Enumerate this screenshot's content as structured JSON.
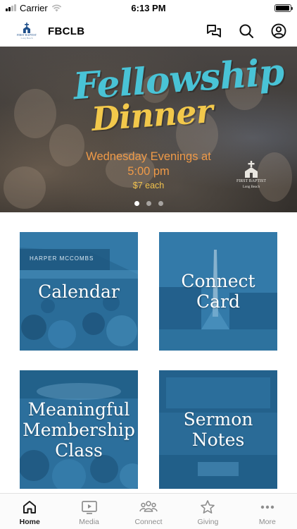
{
  "status_bar": {
    "carrier": "Carrier",
    "time": "6:13 PM",
    "battery_level": 0.95
  },
  "header": {
    "logo_text": "FIRST BAPTIST",
    "logo_subtext": "Long Beach",
    "title": "FBCLB",
    "actions": [
      {
        "name": "messages-icon"
      },
      {
        "name": "search-icon"
      },
      {
        "name": "profile-icon"
      }
    ]
  },
  "banner": {
    "title_line1": "Fellowship",
    "title_line2": "Dinner",
    "when_line1": "Wednesday Evenings at",
    "when_line2": "5:00 pm",
    "price": "$7 each",
    "logo_text": "FIRST BAPTIST",
    "logo_subtext": "Long Beach",
    "slide_count": 3,
    "active_slide": 1,
    "colors": {
      "title1": "#49c3d6",
      "title2": "#f2c84b",
      "when": "#ef9a48",
      "price": "#f1c24d"
    }
  },
  "tiles": [
    {
      "id": "calendar",
      "label_lines": [
        "Calendar"
      ],
      "sign_text": "HARPER MCCOMBS"
    },
    {
      "id": "connect",
      "label_lines": [
        "Connect",
        "Card"
      ]
    },
    {
      "id": "membership",
      "label_lines": [
        "Meaningful",
        "Membership",
        "Class"
      ]
    },
    {
      "id": "sermon",
      "label_lines": [
        "Sermon",
        "Notes"
      ]
    }
  ],
  "tab_bar": {
    "items": [
      {
        "label": "Home",
        "icon": "home-icon",
        "active": true
      },
      {
        "label": "Media",
        "icon": "media-icon",
        "active": false
      },
      {
        "label": "Connect",
        "icon": "people-icon",
        "active": false
      },
      {
        "label": "Giving",
        "icon": "star-icon",
        "active": false
      },
      {
        "label": "More",
        "icon": "more-dots-icon",
        "active": false
      }
    ]
  },
  "theme": {
    "accent_blue": "#2a6c98",
    "tab_active": "#1c1c1c",
    "tab_inactive": "#8e8e8e"
  }
}
